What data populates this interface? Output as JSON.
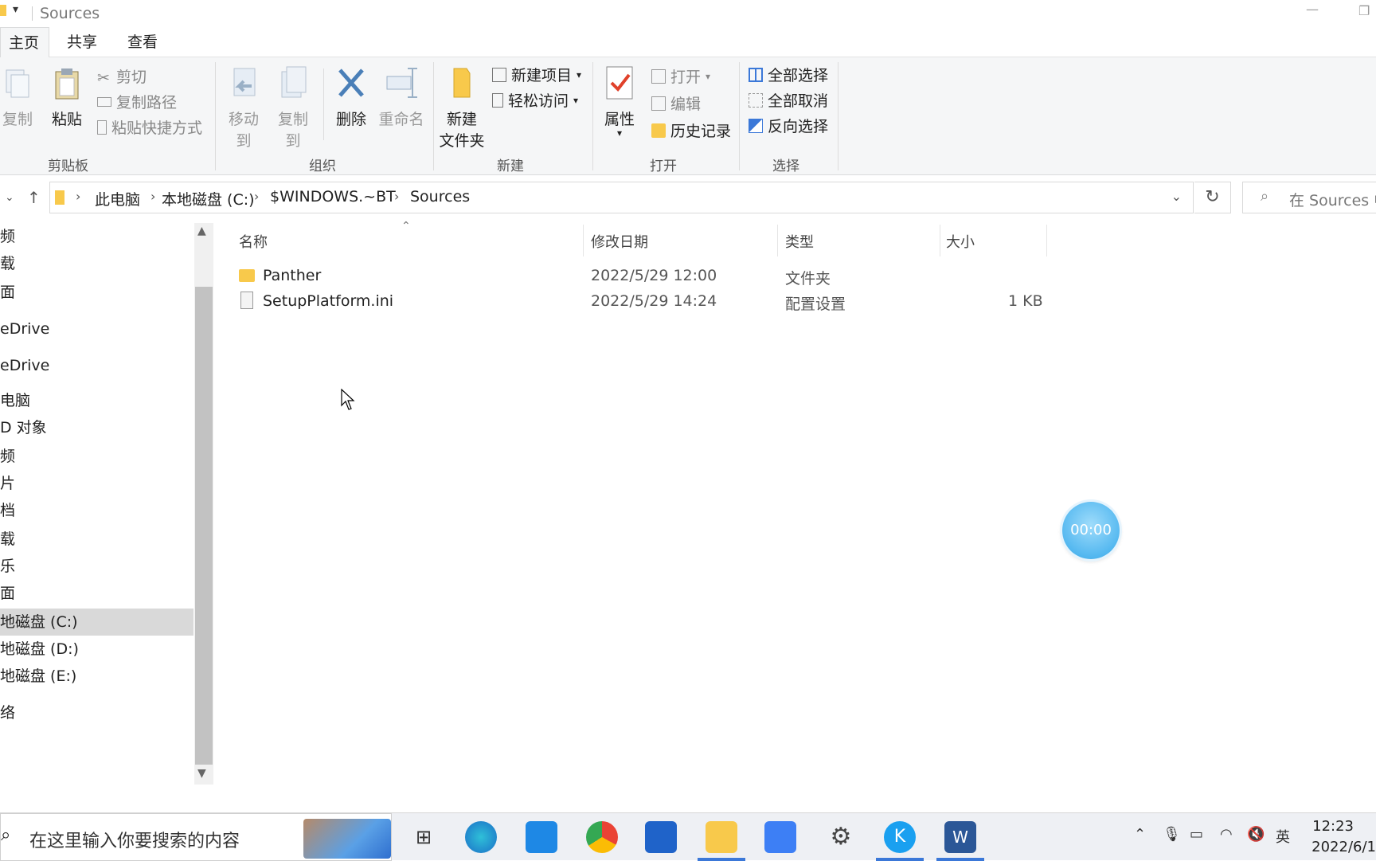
{
  "window": {
    "title": "Sources",
    "quick_access_glyph": "▾"
  },
  "tabs": [
    {
      "label": "主页"
    },
    {
      "label": "共享"
    },
    {
      "label": "查看"
    }
  ],
  "ribbon": {
    "clipboard": {
      "copy": "复制",
      "paste": "粘贴",
      "cut": "剪切",
      "copy_path": "复制路径",
      "paste_shortcut": "粘贴快捷方式",
      "group": "剪贴板"
    },
    "organize": {
      "move_to": "移动到",
      "copy_to": "复制到",
      "delete": "删除",
      "rename": "重命名",
      "group": "组织"
    },
    "new": {
      "new_folder_line1": "新建",
      "new_folder_line2": "文件夹",
      "new_item": "新建项目",
      "easy_access": "轻松访问",
      "group": "新建"
    },
    "open": {
      "properties": "属性",
      "open": "打开",
      "edit": "编辑",
      "history": "历史记录",
      "group": "打开"
    },
    "select": {
      "select_all": "全部选择",
      "select_none": "全部取消",
      "invert": "反向选择",
      "group": "选择"
    }
  },
  "address": {
    "crumbs": [
      "此电脑",
      "本地磁盘 (C:)",
      "$WINDOWS.~BT",
      "Sources"
    ],
    "search_placeholder": "在 Sources 中"
  },
  "sidebar": {
    "items": [
      "频",
      "载",
      "面",
      "eDrive",
      "eDrive",
      "电脑",
      "D 对象",
      "频",
      "片",
      "档",
      "载",
      "乐",
      "面",
      "地磁盘 (C:)",
      "地磁盘 (D:)",
      "地磁盘 (E:)",
      "络"
    ],
    "selected_index": 13
  },
  "columns": {
    "name": "名称",
    "modified": "修改日期",
    "type": "类型",
    "size": "大小"
  },
  "files": [
    {
      "name": "Panther",
      "modified": "2022/5/29 12:00",
      "type": "文件夹",
      "size": "",
      "icon": "folder-icon"
    },
    {
      "name": "SetupPlatform.ini",
      "modified": "2022/5/29 14:24",
      "type": "配置设置",
      "size": "1 KB",
      "icon": "ini-file-icon"
    }
  ],
  "timer": {
    "text": "00:00"
  },
  "taskbar": {
    "search_placeholder": "在这里输入你要搜索的内容",
    "time": "12:23",
    "date": "2022/6/1",
    "ime": "英"
  },
  "colors": {
    "accent": "#3b78d8",
    "folder": "#f8c94b",
    "ribbon_bg": "#f5f6f7",
    "selected": "#d9d9d9"
  }
}
